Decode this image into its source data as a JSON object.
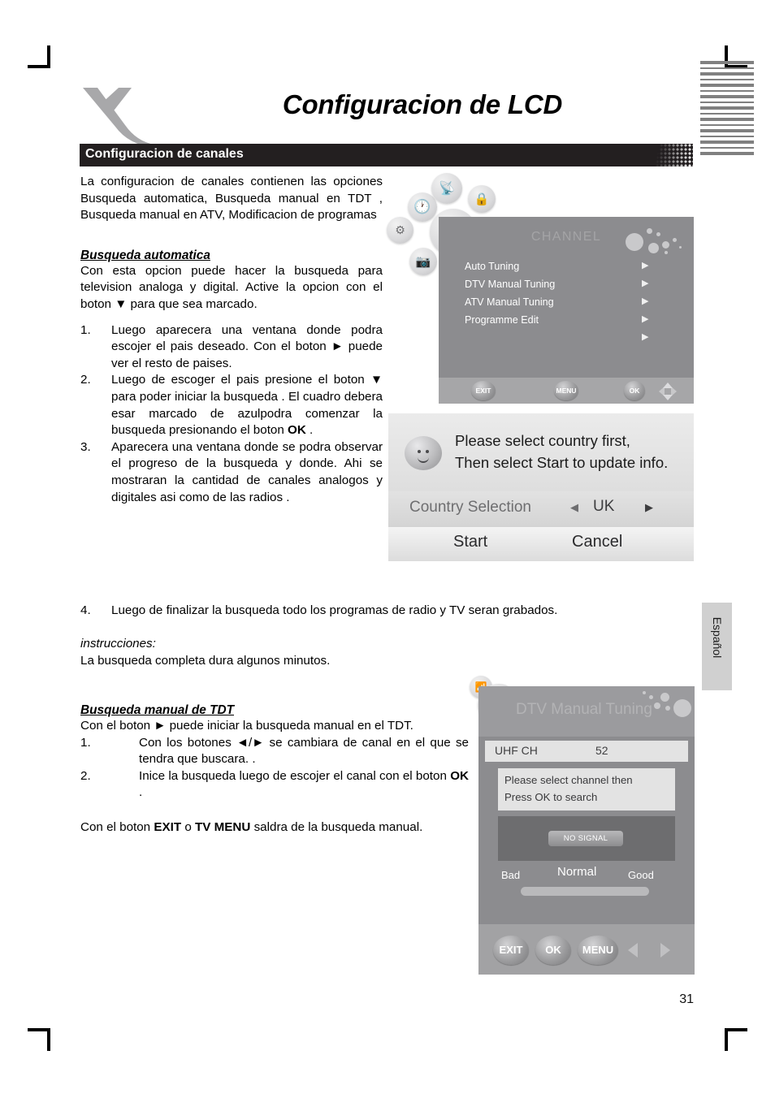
{
  "document": {
    "title": "Configuracion de LCD",
    "section_heading": "Configuracion de canales",
    "page_number": "31",
    "side_tab_label": "Español",
    "logo": "x-logo"
  },
  "content": {
    "intro": "La configuracion de canales contienen las opciones  Busqueda automatica, Busqueda manual en TDT , Busqueda manual en ATV, Modificacion de programas",
    "auto_search": {
      "heading": "Busqueda automatica",
      "body": "Con esta opcion puede hacer la busqueda para television analoga y digital. Active la opcion con el boton ▼    para que sea marcado.",
      "steps": [
        {
          "num": "1.",
          "text": "Luego aparecera una ventana donde podra escojer el pais deseado. Con el boton ► puede ver el resto de paises."
        },
        {
          "num": "2.",
          "text_a": "Luego de escoger el pais presione el boton ▼ para poder iniciar la busqueda . El cuadro debera esar marcado de azulpodra comenzar la busqueda presionando el boton ",
          "bold": "OK",
          "text_b": " ."
        },
        {
          "num": "3.",
          "text": "Aparecera una ventana donde se podra observar el progreso de la busqueda y donde. Ahi se mostraran la cantidad de canales analogos y digitales asi como de las radios ."
        },
        {
          "num": "4.",
          "text": "Luego de finalizar la busqueda todo los programas de radio y TV seran grabados."
        }
      ]
    },
    "note": {
      "label": "instrucciones:",
      "text": "La busqueda completa dura algunos minutos."
    },
    "manual_search": {
      "heading": "Busqueda manual de TDT",
      "body": "Con el boton ► puede iniciar la busqueda manual en el TDT.",
      "steps": [
        {
          "num": "1.",
          "text": "Con los botones ◄/► se cambiara de canal en el que se tendra que buscara. ."
        },
        {
          "num": "2.",
          "text_a": "Inice la busqueda luego de escojer el canal con el boton ",
          "bold": "OK",
          "text_b": " ."
        }
      ],
      "exit_note_a": "Con el boton ",
      "exit_bold_1": "EXIT",
      "exit_note_b": " o ",
      "exit_bold_2": "TV MENU",
      "exit_note_c": " saldra de la busqueda manual."
    }
  },
  "osd_channel": {
    "title": "CHANNEL",
    "items": [
      {
        "label": "Auto Tuning",
        "arrow": "▶"
      },
      {
        "label": "DTV Manual Tuning",
        "arrow": "▶"
      },
      {
        "label": "ATV Manual Tuning",
        "arrow": "▶"
      },
      {
        "label": "Programme Edit",
        "arrow": "▶"
      },
      {
        "label": "",
        "arrow": "▶"
      }
    ],
    "buttons": [
      {
        "label": "EXIT"
      },
      {
        "label": "MENU"
      },
      {
        "label": "OK"
      }
    ],
    "cluster_icons": [
      "clock-icon",
      "antenna-icon",
      "lock-icon",
      "tv-icon",
      "setup-icon",
      "camera-icon"
    ]
  },
  "osd_country": {
    "message_line1": "Please select country first,",
    "message_line2": "Then select Start to update info.",
    "selection_label": "Country Selection",
    "selection_value": "UK",
    "left_arrow": "◀",
    "right_arrow": "▶",
    "start_label": "Start",
    "cancel_label": "Cancel"
  },
  "osd_dtv": {
    "title": "DTV Manual Tuning",
    "channel_label": "UHF  CH",
    "channel_value": "52",
    "hint_line1": "Please select channel then",
    "hint_line2": "Press OK to search",
    "no_signal": "NO SIGNAL",
    "quality": {
      "bad": "Bad",
      "normal": "Normal",
      "good": "Good"
    },
    "buttons": [
      {
        "label": "EXIT"
      },
      {
        "label": "OK"
      },
      {
        "label": "MENU"
      }
    ]
  },
  "colors": {
    "bar_black": "#231f20",
    "osd_gray": "#8c8c8f",
    "osd_footer_gray": "#a6a6a8",
    "dialog_light": "#e8e8e8",
    "side_tab_gray": "#d0d0d0",
    "logo_gray": "#a8a8aa"
  }
}
